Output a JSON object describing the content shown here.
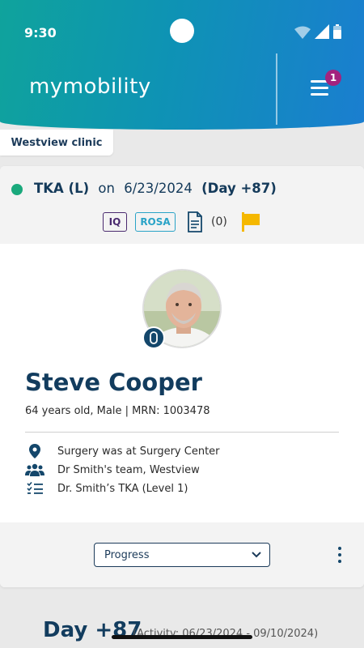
{
  "status_bar": {
    "time": "9:30"
  },
  "header": {
    "app_name": "mymobility",
    "notification_count": "1"
  },
  "clinic": {
    "name": "Westview clinic"
  },
  "procedure": {
    "name": "TKA (L)",
    "on_word": "on",
    "date": "6/23/2024",
    "day": "(Day +87)",
    "status_color": "#1aa97c"
  },
  "tags": {
    "iq": "IQ",
    "rosa": "ROSA",
    "doc_count": "(0)",
    "flag_color": "#f5b800"
  },
  "patient": {
    "name": "Steve Cooper",
    "info": "64 years old, Male | MRN: 1003478"
  },
  "details": [
    {
      "icon": "location-pin-icon",
      "text": "Surgery was at Surgery Center"
    },
    {
      "icon": "team-icon",
      "text": "Dr Smith's team, Westview"
    },
    {
      "icon": "checklist-icon",
      "text": "Dr. Smith’s TKA (Level 1)"
    }
  ],
  "view_select": {
    "value": "Progress"
  },
  "day_section": {
    "title": "Day +87",
    "activity": "(Activity: 06/23/2024 - 09/10/2024)"
  }
}
